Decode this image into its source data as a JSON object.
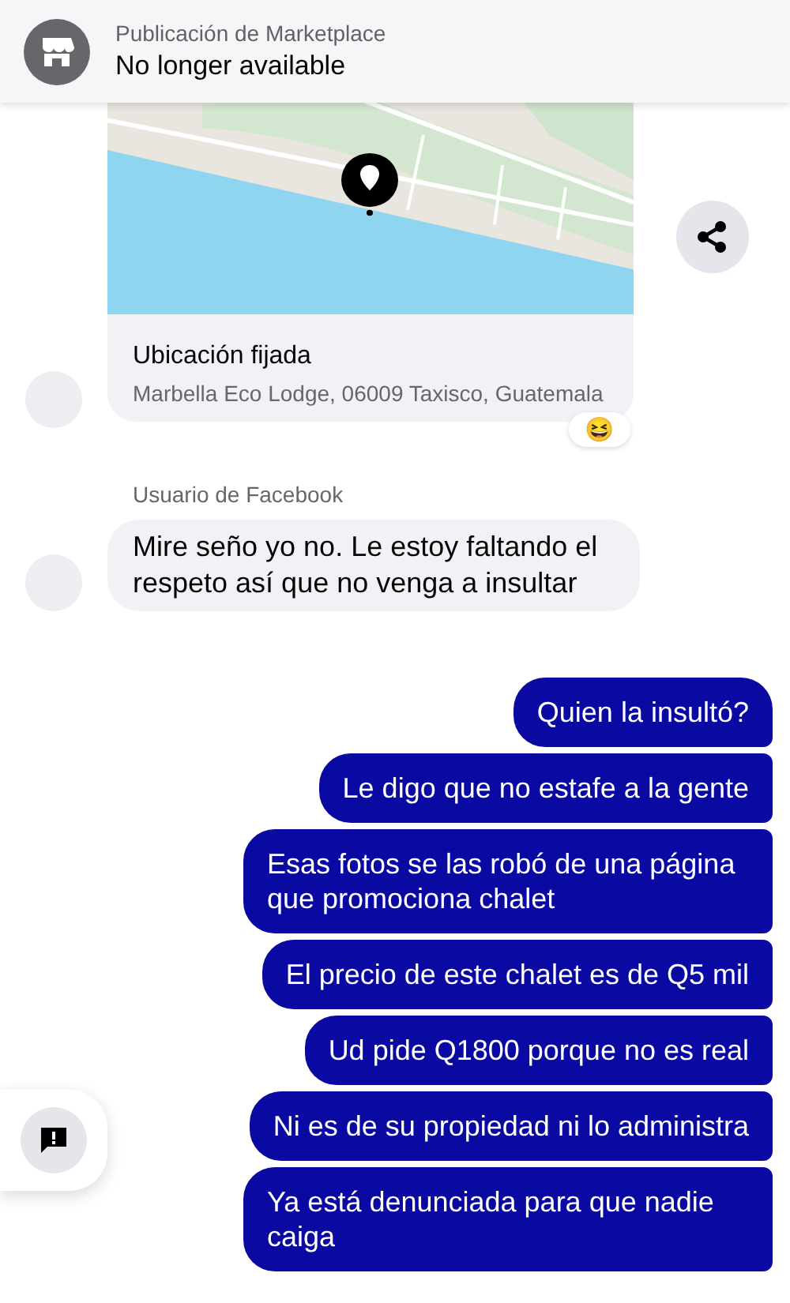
{
  "header": {
    "subtitle": "Publicación de Marketplace",
    "title": "No longer available"
  },
  "location_card": {
    "title": "Ubicación fijada",
    "address": "Marbella Eco Lodge, 06009 Taxisco, Guatemala",
    "reaction": "😆"
  },
  "incoming": {
    "sender": "Usuario de Facebook",
    "text": "Mire seño yo no. Le estoy faltando el respeto así que no venga a insultar"
  },
  "outgoing": [
    {
      "text": "Quien la insultó?"
    },
    {
      "text": "Le digo que no estafe a la gente"
    },
    {
      "text": "Esas fotos se las robó de una página que promociona chalet"
    },
    {
      "text": "El precio de este chalet es de Q5 mil"
    },
    {
      "text": "Ud pide Q1800 porque no es real"
    },
    {
      "text": "Ni es de su propiedad ni lo administra"
    },
    {
      "text": "Ya está denunciada para que nadie caiga"
    }
  ]
}
